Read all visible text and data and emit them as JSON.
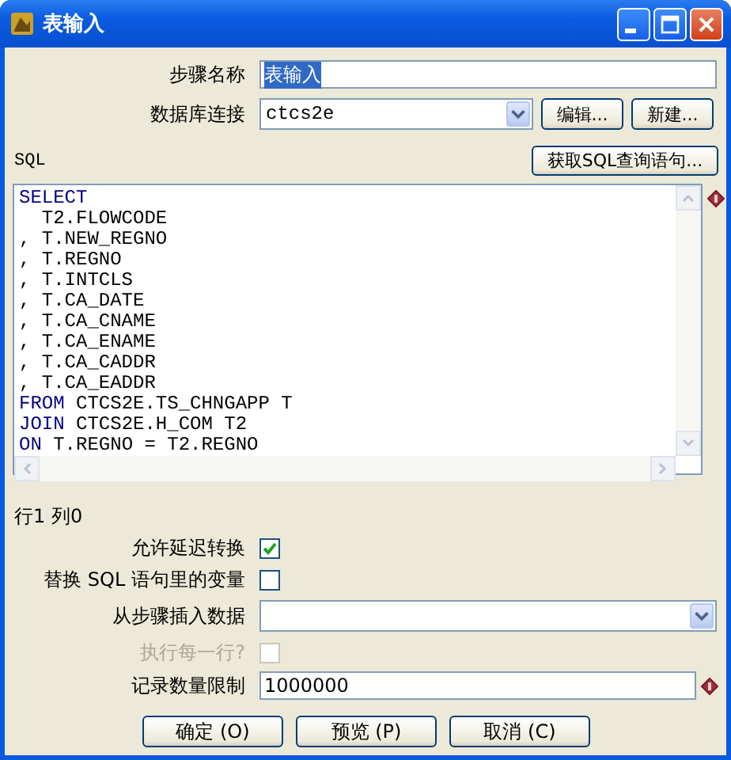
{
  "window": {
    "title": "表输入"
  },
  "step_name": {
    "label": "步骤名称",
    "value": "表输入",
    "highlighted": true
  },
  "connection": {
    "label": "数据库连接",
    "value": "ctcs2e",
    "buttons": [
      "编辑...",
      "新建..."
    ]
  },
  "sql": {
    "label": "SQL",
    "get_button": "获取SQL查询语句...",
    "lines": [
      {
        "keyword": "SELECT"
      },
      {
        "rest": "  T2.FLOWCODE"
      },
      {
        "rest": ", T.NEW_REGNO"
      },
      {
        "rest": ", T.REGNO"
      },
      {
        "rest": ", T.INTCLS"
      },
      {
        "rest": ", T.CA_DATE"
      },
      {
        "rest": ", T.CA_CNAME"
      },
      {
        "rest": ", T.CA_ENAME"
      },
      {
        "rest": ", T.CA_CADDR"
      },
      {
        "rest": ", T.CA_EADDR"
      },
      {
        "keyword": "FROM",
        "rest": " CTCS2E.TS_CHNGAPP T"
      },
      {
        "keyword": "JOIN",
        "rest": " CTCS2E.H_COM T2"
      },
      {
        "keyword": "ON",
        "rest": " T.REGNO = T2.REGNO"
      }
    ]
  },
  "cursor_position": "行1 列0",
  "options": [
    {
      "label": "允许延迟转换",
      "checked": true,
      "disabled": false
    },
    {
      "label": "替换 SQL 语句里的变量",
      "checked": false,
      "disabled": false
    }
  ],
  "insert_from_step": {
    "label": "从步骤插入数据"
  },
  "execute_each_row": {
    "label": "执行每一行?",
    "checked": false,
    "disabled": true
  },
  "limit": {
    "label": "记录数量限制",
    "value": "1000000"
  },
  "buttons": [
    "确定 (O)",
    "预览 (P)",
    "取消 (C)"
  ]
}
